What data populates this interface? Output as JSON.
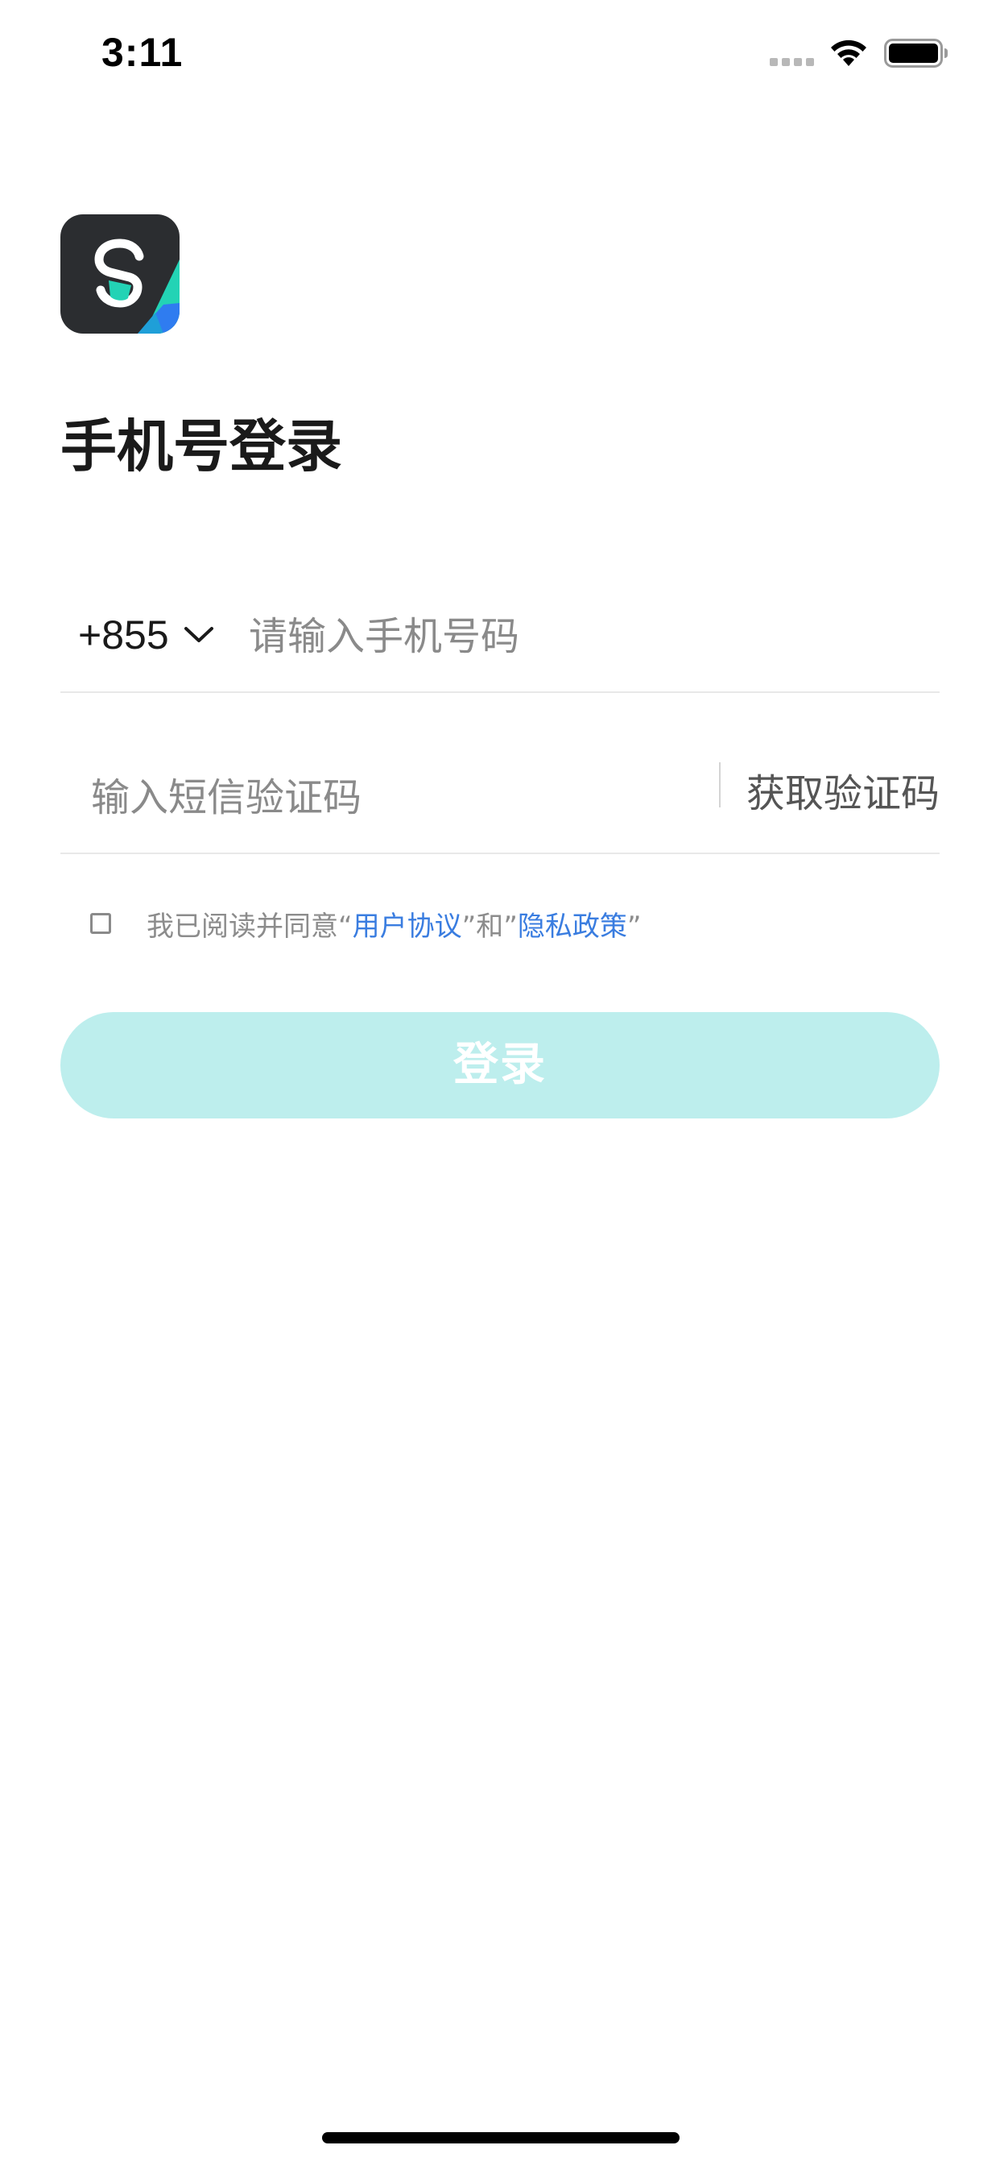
{
  "status_bar": {
    "time": "3:11"
  },
  "logo": {
    "icon": "app-logo-icon",
    "colors": {
      "background": "#2b2d30",
      "accent_teal": "#23d3b5",
      "accent_blue": "#2f7cf0"
    }
  },
  "page": {
    "title": "手机号登录"
  },
  "phone": {
    "country_code": "+855",
    "placeholder": "请输入手机号码",
    "value": ""
  },
  "code": {
    "placeholder": "输入短信验证码",
    "value": "",
    "get_code_label": "获取验证码"
  },
  "agreement": {
    "checked": false,
    "prefix": "我已阅读并同意“",
    "user_agreement": "用户协议",
    "middle": "”和”",
    "privacy_policy": "隐私政策",
    "suffix": "”",
    "link_color": "#3a7de0"
  },
  "login": {
    "label": "登录",
    "background_color": "#bdeeed"
  }
}
